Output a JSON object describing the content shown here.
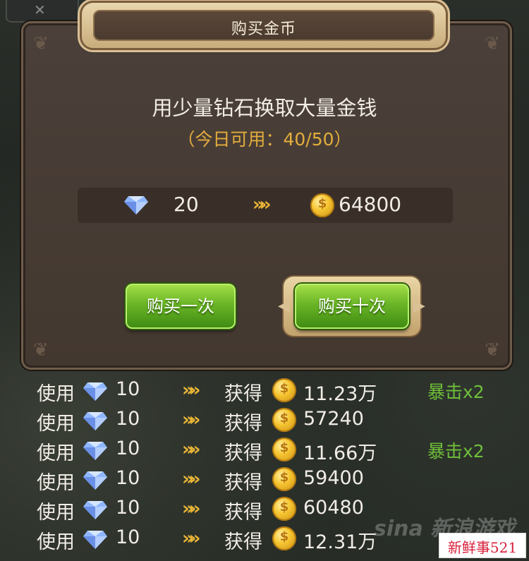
{
  "dialog": {
    "title": "购买金币",
    "heading": "用少量钻石换取大量金钱",
    "daily_limit": "（今日可用：40/50）",
    "exchange": {
      "diamond_cost": "20",
      "gold_amount": "64800"
    },
    "buttons": {
      "buy_once": "购买一次",
      "buy_ten": "购买十次"
    }
  },
  "log": {
    "use_label": "使用",
    "gain_label": "获得",
    "rows": [
      {
        "cost": "10",
        "gain": "11.23万",
        "crit": "暴击x2"
      },
      {
        "cost": "10",
        "gain": "57240",
        "crit": ""
      },
      {
        "cost": "10",
        "gain": "11.66万",
        "crit": "暴击x2"
      },
      {
        "cost": "10",
        "gain": "59400",
        "crit": ""
      },
      {
        "cost": "10",
        "gain": "60480",
        "crit": ""
      },
      {
        "cost": "10",
        "gain": "12.31万",
        "crit": ""
      }
    ]
  },
  "watermark": {
    "sina": "sina 新浪游戏",
    "site": "新鲜事521"
  },
  "colors": {
    "accent_gold": "#e3ad3c",
    "button_green": "#6ab526",
    "crit_green": "#6fbf3a"
  },
  "icons": [
    "diamond-icon",
    "gold-coin-icon",
    "triple-chevron-icon",
    "close-icon"
  ]
}
